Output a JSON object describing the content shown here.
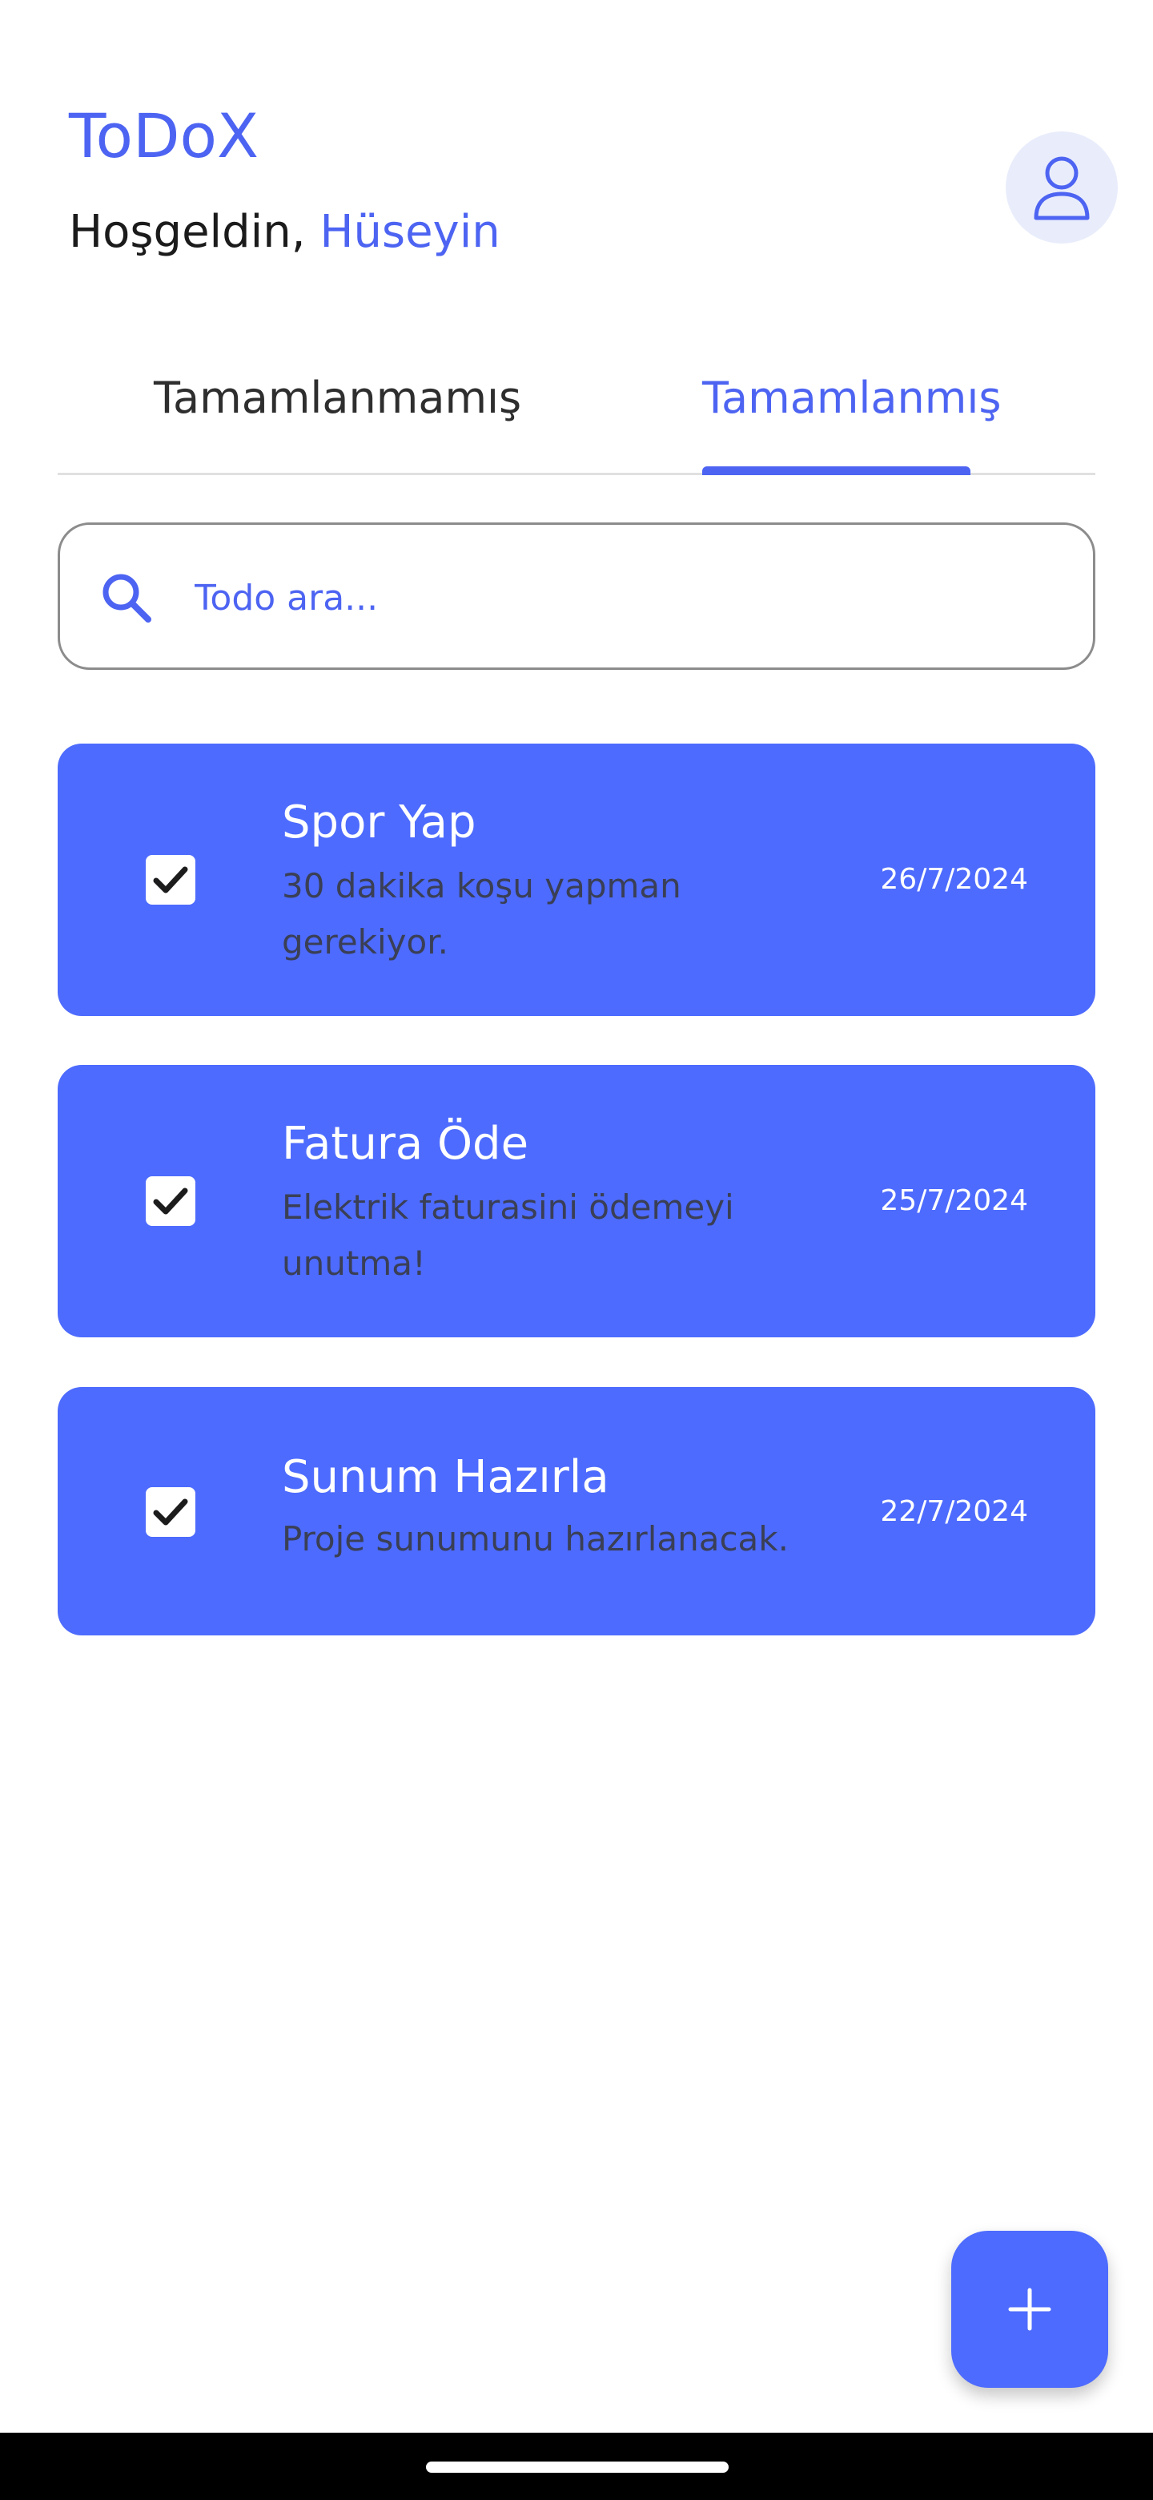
{
  "header": {
    "app_title": "ToDoX",
    "greeting_prefix": "Hoşgeldin,",
    "user_name": "Hüseyin",
    "profile_icon": "user-icon"
  },
  "tabs": {
    "incomplete_label": "Tamamlanmamış",
    "complete_label": "Tamamlanmış",
    "active": "complete"
  },
  "search": {
    "placeholder": "Todo ara...",
    "value": "",
    "icon": "search-icon"
  },
  "todos": [
    {
      "title": "Spor Yap",
      "description": "30 dakika koşu yapman gerekiyor.",
      "date": "26/7/2024",
      "completed": true
    },
    {
      "title": "Fatura Öde",
      "description": "Elektrik faturasini ödemeyi unutma!",
      "date": "25/7/2024",
      "completed": true
    },
    {
      "title": "Sunum Hazırla",
      "description": "Proje sunumunu hazırlanacak.",
      "date": "22/7/2024",
      "completed": true
    }
  ],
  "fab": {
    "icon": "plus-icon"
  },
  "colors": {
    "accent": "#4d64f2",
    "card": "#4d6bfe",
    "card_description": "#3a3f55",
    "profile_bg": "#e9edfb"
  }
}
